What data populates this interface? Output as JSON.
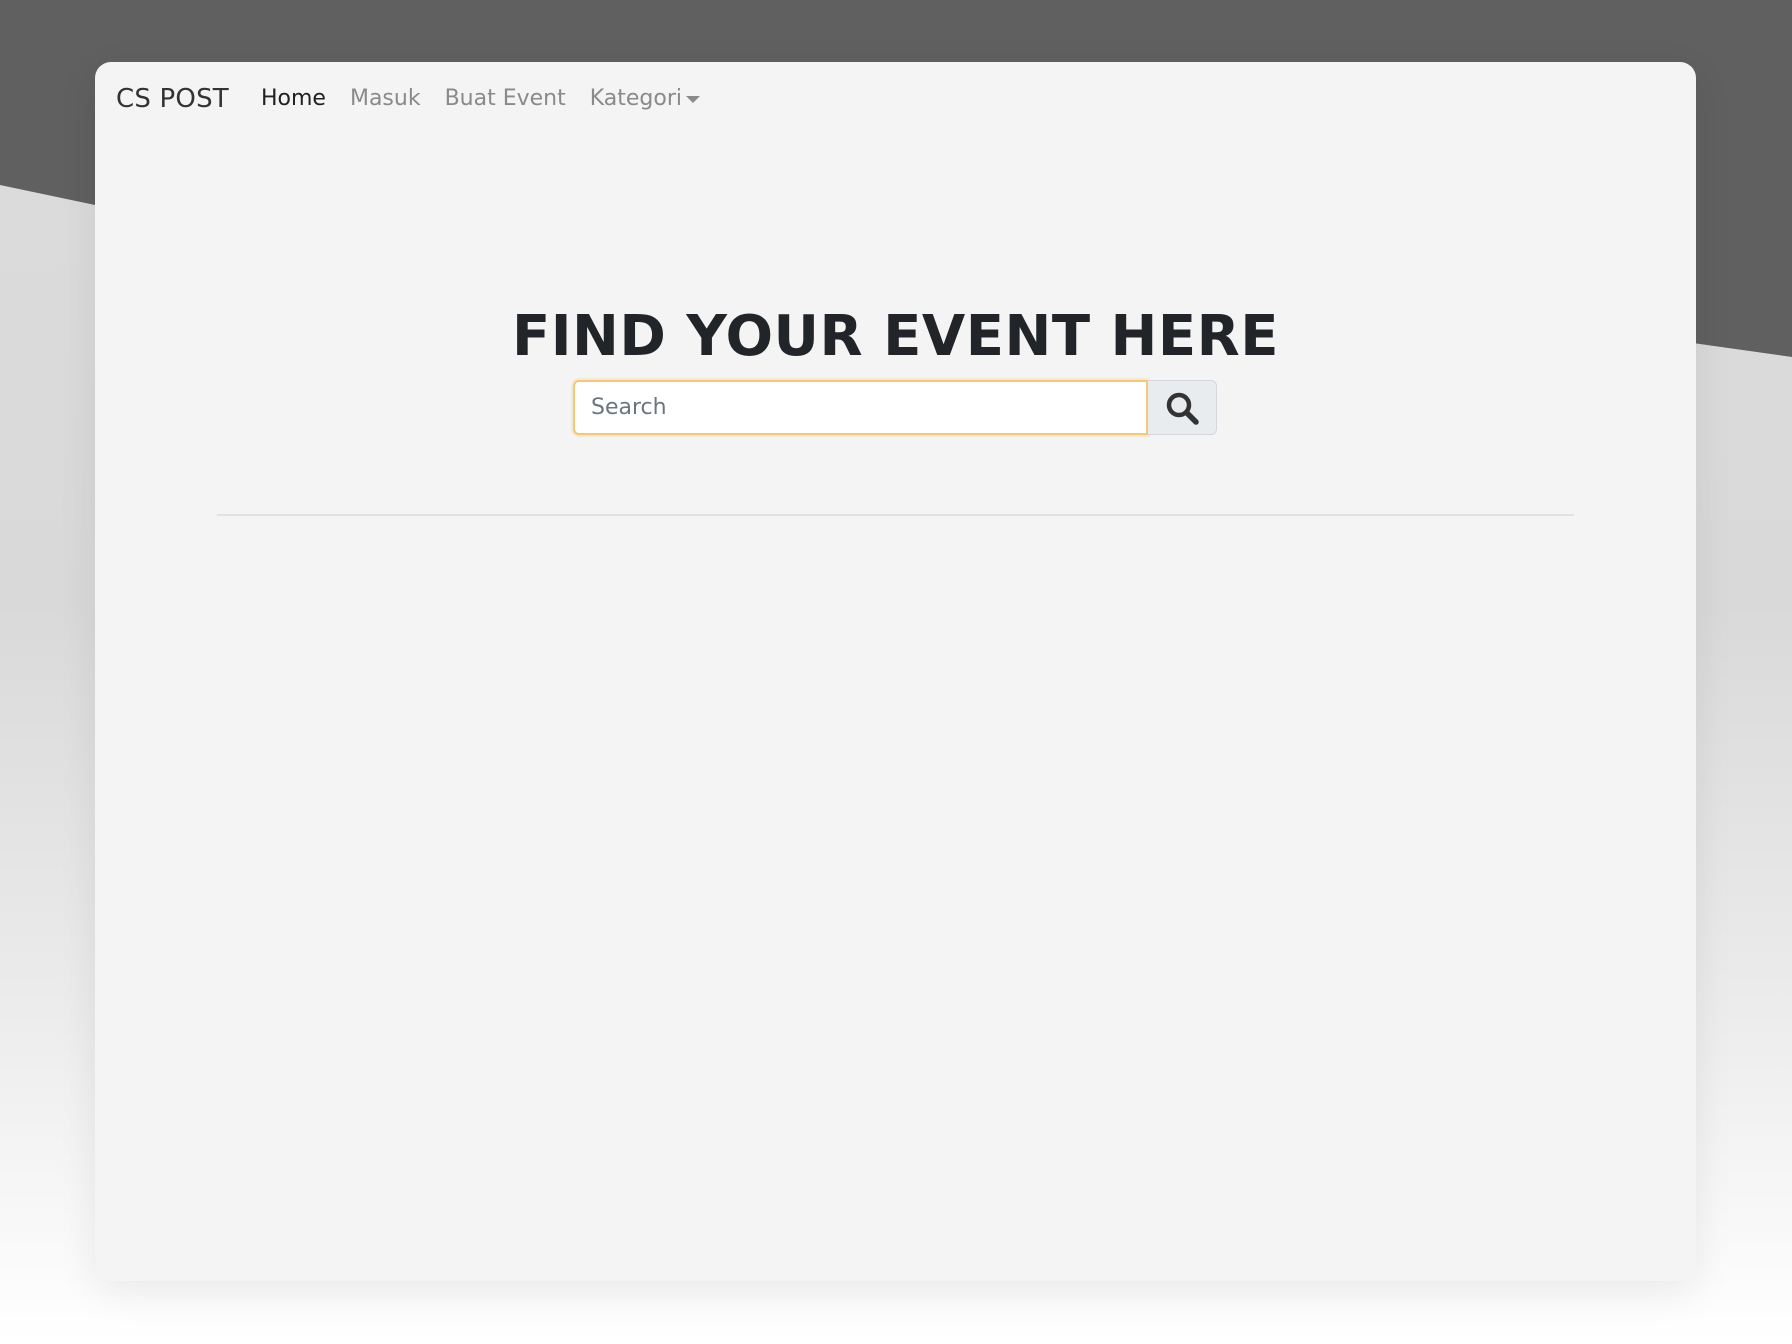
{
  "colors": {
    "backdrop_dark": "#606060",
    "window_bg": "#f4f4f4",
    "search_border": "#f5c77a",
    "title_text": "#212529",
    "nav_active": "#212121",
    "nav_inactive": "#8a8a8a"
  },
  "navbar": {
    "brand": "CS POST",
    "links": [
      {
        "label": "Home",
        "active": true
      },
      {
        "label": "Masuk",
        "active": false
      },
      {
        "label": "Buat Event",
        "active": false
      }
    ],
    "dropdown": {
      "label": "Kategori",
      "icon": "caret-down-icon"
    }
  },
  "hero": {
    "title": "FIND YOUR EVENT HERE"
  },
  "search": {
    "placeholder": "Search",
    "value": "",
    "button_icon": "search-icon"
  }
}
